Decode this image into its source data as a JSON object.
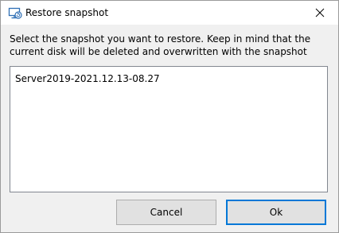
{
  "window": {
    "title": "Restore snapshot",
    "app_icon": "virtual-machine-restore-icon",
    "close_icon": "close-icon"
  },
  "dialog": {
    "instruction": "Select the snapshot you want to restore. Keep in mind that the current disk will be deleted and overwritten with the snapshot",
    "snapshots": [
      "Server2019-2021.12.13-08.27"
    ],
    "cancel_label": "Cancel",
    "ok_label": "Ok"
  },
  "colors": {
    "accent": "#0078d7",
    "background": "#f0f0f0",
    "button": "#e1e1e1"
  }
}
